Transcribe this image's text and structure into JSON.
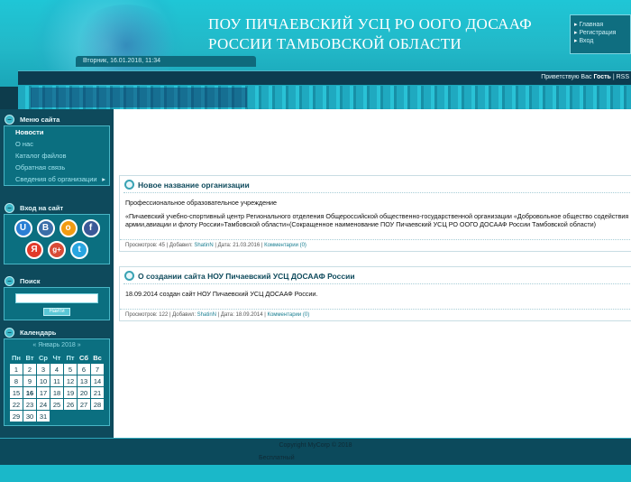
{
  "site": {
    "title_line1": "ПОУ ПИЧАЕВСКИЙ УСЦ РО ООГО ДОСААФ",
    "title_line2": "РОССИИ ТАМБОВСКОЙ ОБЛАСТИ"
  },
  "top_menu": [
    "Главная",
    "Регистрация",
    "Вход"
  ],
  "date_text": "Вторник, 16.01.2018, 11:34",
  "greeting": {
    "prefix": "Приветствую Вас ",
    "user": "Гость",
    "sep": " | ",
    "rss": "RSS"
  },
  "sidebar": {
    "menu": {
      "title": "Меню сайта",
      "items": [
        {
          "label": "Новости"
        },
        {
          "label": "О нас"
        },
        {
          "label": "Каталог файлов"
        },
        {
          "label": "Обратная связь"
        },
        {
          "label": "Сведения об организации",
          "arrow": "▸"
        }
      ]
    },
    "login": {
      "title": "Вход на сайт",
      "icons": [
        {
          "label": "U",
          "color": "#2a7fd4"
        },
        {
          "label": "B",
          "color": "#3a6ea8"
        },
        {
          "label": "о",
          "color": "#f29b12"
        },
        {
          "label": "f",
          "color": "#3b5998"
        },
        {
          "label": "Я",
          "color": "#e23a2a"
        },
        {
          "label": "g+",
          "color": "#d84b37"
        },
        {
          "label": "t",
          "color": "#28a5e0"
        }
      ]
    },
    "search": {
      "title": "Поиск",
      "button": "Найти"
    },
    "calendar": {
      "title": "Календарь",
      "caption": "«  Январь 2018  »",
      "days": [
        "Пн",
        "Вт",
        "Ср",
        "Чт",
        "Пт",
        "Сб",
        "Вс"
      ],
      "weeks": [
        [
          "1",
          "2",
          "3",
          "4",
          "5",
          "6",
          "7"
        ],
        [
          "8",
          "9",
          "10",
          "11",
          "12",
          "13",
          "14"
        ],
        [
          "15",
          "16",
          "17",
          "18",
          "19",
          "20",
          "21"
        ],
        [
          "22",
          "23",
          "24",
          "25",
          "26",
          "27",
          "28"
        ],
        [
          "29",
          "30",
          "31",
          "",
          "",
          "",
          ""
        ]
      ],
      "today": "16"
    }
  },
  "posts": [
    {
      "title": "Новое название организации",
      "paragraphs": [
        "Профессиональное образовательное учреждение",
        "«Пичаевский учебно-спортивный центр Регионального отделения Общероссийской общественно-государственной организации «Добровольное общество содействия армии,авиации и флоту России»Тамбовской области»(Сокращенное  наименование ПОУ Пичаевский УСЦ РО ООГО ДОСААФ России Тамбовской области)"
      ],
      "meta": {
        "views_label": "Просмотров: ",
        "views": "45",
        "added_label": " | Добавил: ",
        "author": "ShatinN",
        "date_label": " | Дата: ",
        "date": "21.03.2016",
        "comments": "Комментарии (0)"
      }
    },
    {
      "title": "О создании сайта НОУ Пичаевский УСЦ ДОСААФ России",
      "paragraphs": [
        "18.09.2014 создан сайт НОУ Пичаевский УСЦ ДОСААФ России."
      ],
      "meta": {
        "views_label": "Просмотров: ",
        "views": "122",
        "added_label": " | Добавил: ",
        "author": "ShatinN",
        "date_label": " | Дата: ",
        "date": "18.09.2014",
        "comments": "Комментарии (0)"
      }
    }
  ],
  "footer": {
    "copyright": "Copyright MyCorp © 2018",
    "hosting": "Бесплатный"
  }
}
